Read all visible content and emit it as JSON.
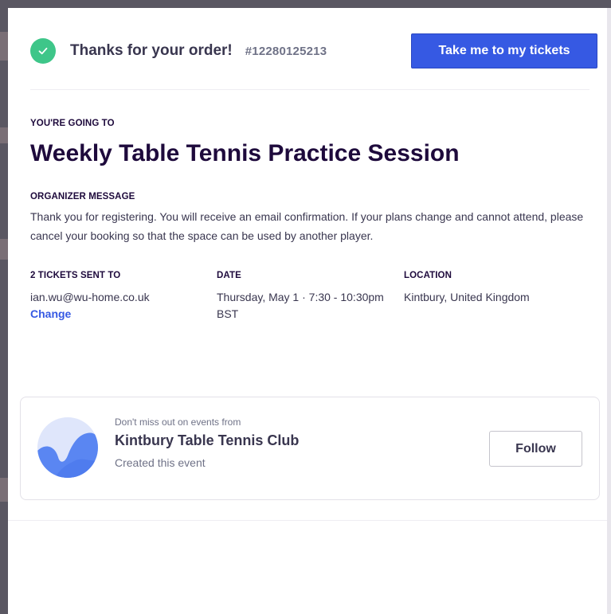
{
  "header": {
    "thanks": "Thanks for your order!",
    "order_number": "#12280125213",
    "tickets_button": "Take me to my tickets",
    "check_icon": "check-icon"
  },
  "event": {
    "going_label": "YOU'RE GOING TO",
    "title": "Weekly Table Tennis Practice Session"
  },
  "organizer_message": {
    "label": "ORGANIZER MESSAGE",
    "text": "Thank you for registering. You will receive an email confirmation. If your plans change and cannot attend, please cancel your booking so that the space can be used by another player."
  },
  "details": {
    "tickets": {
      "label": "2 TICKETS SENT TO",
      "email": "ian.wu@wu-home.co.uk",
      "change_link": "Change"
    },
    "date": {
      "label": "DATE",
      "value": "Thursday, May 1 · 7:30 - 10:30pm BST"
    },
    "location": {
      "label": "LOCATION",
      "value": "Kintbury, United Kingdom"
    }
  },
  "organizer_card": {
    "prompt": "Don't miss out on events from",
    "name": "Kintbury Table Tennis Club",
    "subtitle": "Created this event",
    "follow_button": "Follow",
    "avatar_icon": "organizer-logo-icon"
  },
  "colors": {
    "accent": "#3659e3",
    "success": "#3ec689",
    "heading": "#1e0a3c",
    "body_text": "#39364f",
    "muted_text": "#6f7287"
  }
}
